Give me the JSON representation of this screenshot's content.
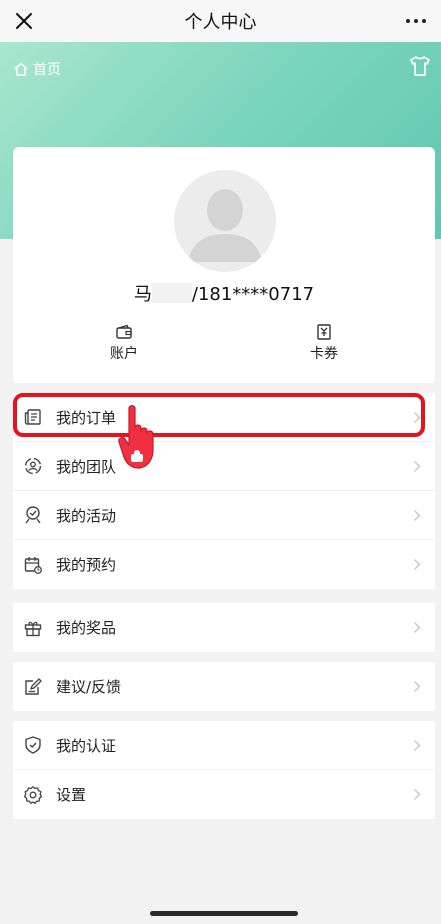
{
  "topbar": {
    "title": "个人中心"
  },
  "banner": {
    "home_label": "首页"
  },
  "profile": {
    "name_prefix": "马",
    "name_suffix": "/181****0717"
  },
  "quick_links": [
    {
      "label": "账户",
      "icon": "wallet-icon"
    },
    {
      "label": "卡券",
      "icon": "coupon-icon"
    }
  ],
  "menu": {
    "group1": [
      {
        "label": "我的订单",
        "icon": "order-icon"
      },
      {
        "label": "我的团队",
        "icon": "team-icon"
      },
      {
        "label": "我的活动",
        "icon": "activity-icon"
      },
      {
        "label": "我的预约",
        "icon": "calendar-icon"
      }
    ],
    "group2": [
      {
        "label": "我的奖品",
        "icon": "gift-icon"
      }
    ],
    "group3": [
      {
        "label": "建议/反馈",
        "icon": "feedback-icon"
      }
    ],
    "group4": [
      {
        "label": "我的认证",
        "icon": "shield-icon"
      },
      {
        "label": "设置",
        "icon": "gear-icon"
      }
    ]
  },
  "colors": {
    "banner_start": "#a9e6cf",
    "banner_end": "#5ec7b1",
    "highlight": "#e3131f"
  }
}
